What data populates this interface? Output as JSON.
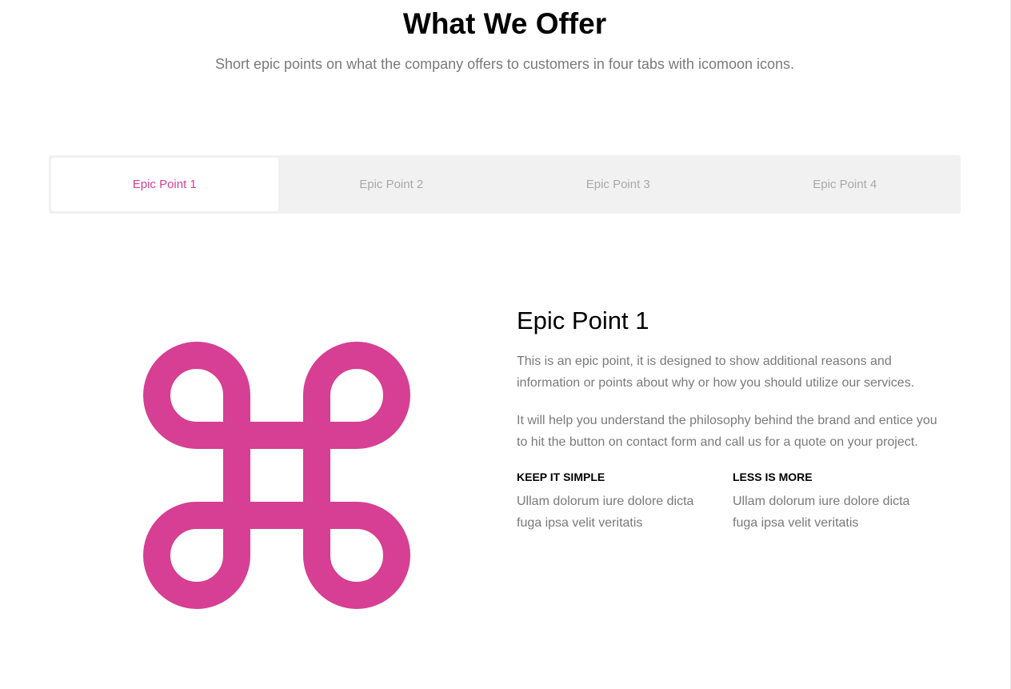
{
  "header": {
    "title": "What We Offer",
    "subtitle": "Short epic points on what the company offers to customers in four tabs with icomoon icons."
  },
  "tabs": [
    {
      "label": "Epic Point 1",
      "active": true
    },
    {
      "label": "Epic Point 2",
      "active": false
    },
    {
      "label": "Epic Point 3",
      "active": false
    },
    {
      "label": "Epic Point 4",
      "active": false
    }
  ],
  "panel": {
    "icon": "command-icon",
    "title": "Epic Point 1",
    "paragraph1": "This is an epic point, it is designed to show additional reasons and information or points about why or how you should utilize our services.",
    "paragraph2": "It will help you understand the philosophy behind the brand and entice you to hit the button on contact form and call us for a quote on your project.",
    "features": [
      {
        "title": "Keep it simple",
        "text": "Ullam dolorum iure dolore dicta fuga ipsa velit veritatis"
      },
      {
        "title": "Less is more",
        "text": "Ullam dolorum iure dolore dicta fuga ipsa velit veritatis"
      }
    ]
  },
  "colors": {
    "accent": "#d63f93",
    "tab_bar": "#f1f1f1",
    "muted_text": "#7a7a7a",
    "inactive_tab_text": "#a9a9a9"
  }
}
